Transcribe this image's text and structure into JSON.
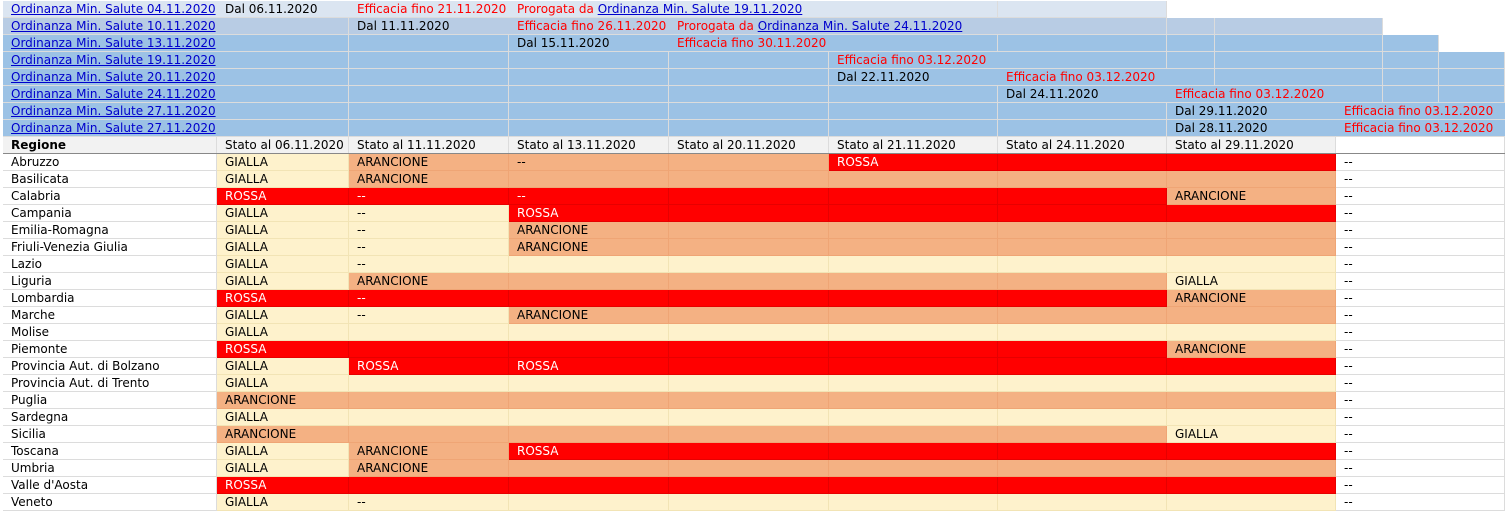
{
  "colors": {
    "ord_a": "#dbe5f1",
    "ord_b": "#b8cce4",
    "ord_c": "#9cc2e5",
    "header": "#f2f2f2",
    "gialla": "#fef2cc",
    "arancione": "#f4b183",
    "rossa": "#ff0000",
    "white": "#ffffff",
    "red_text": "#ff0000",
    "link": "#0000cc"
  },
  "ordinanze": [
    {
      "fill": "ord_a",
      "bands": 7,
      "cells": [
        {
          "col": 0,
          "parts": [
            {
              "t": "Ordinanza Min. Salute 04.11.2020",
              "s": "link"
            }
          ]
        },
        {
          "col": 1,
          "parts": [
            {
              "t": "Dal 06.11.2020"
            }
          ]
        },
        {
          "col": 2,
          "parts": [
            {
              "t": "Efficacia fino 21.11.2020",
              "s": "red"
            }
          ]
        },
        {
          "col": 3,
          "parts": [
            {
              "t": "Prorogata da ",
              "s": "red"
            },
            {
              "t": "Ordinanza Min. Salute 19.11.2020",
              "s": "link"
            }
          ]
        }
      ]
    },
    {
      "fill": "ord_b",
      "bands": 9,
      "cells": [
        {
          "col": 0,
          "parts": [
            {
              "t": "Ordinanza Min. Salute 10.11.2020",
              "s": "link"
            }
          ]
        },
        {
          "col": 2,
          "parts": [
            {
              "t": "Dal 11.11.2020"
            }
          ]
        },
        {
          "col": 3,
          "parts": [
            {
              "t": "Efficacia fino 26.11.2020",
              "s": "red"
            }
          ]
        },
        {
          "col": 4,
          "parts": [
            {
              "t": "Prorogata da ",
              "s": "red"
            },
            {
              "t": "Ordinanza Min. Salute 24.11.2020",
              "s": "link"
            }
          ]
        }
      ]
    },
    {
      "fill": "ord_c",
      "bands": 10,
      "cells": [
        {
          "col": 0,
          "parts": [
            {
              "t": "Ordinanza Min. Salute 13.11.2020",
              "s": "link"
            }
          ]
        },
        {
          "col": 3,
          "parts": [
            {
              "t": "Dal 15.11.2020"
            }
          ]
        },
        {
          "col": 4,
          "parts": [
            {
              "t": "Efficacia fino 30.11.2020",
              "s": "red"
            }
          ]
        }
      ]
    },
    {
      "fill": "ord_c",
      "bands": 11,
      "cells": [
        {
          "col": 0,
          "parts": [
            {
              "t": "Ordinanza Min. Salute 19.11.2020",
              "s": "link"
            }
          ]
        },
        {
          "col": 5,
          "parts": [
            {
              "t": "Efficacia fino 03.12.2020",
              "s": "red"
            }
          ]
        }
      ]
    },
    {
      "fill": "ord_c",
      "bands": 11,
      "cells": [
        {
          "col": 0,
          "parts": [
            {
              "t": "Ordinanza Min. Salute 20.11.2020",
              "s": "link"
            }
          ]
        },
        {
          "col": 5,
          "parts": [
            {
              "t": "Dal 22.11.2020"
            }
          ]
        },
        {
          "col": 6,
          "parts": [
            {
              "t": "Efficacia fino 03.12.2020",
              "s": "red"
            }
          ]
        }
      ]
    },
    {
      "fill": "ord_c",
      "bands": 11,
      "cells": [
        {
          "col": 0,
          "parts": [
            {
              "t": "Ordinanza Min. Salute 24.11.2020",
              "s": "link"
            }
          ]
        },
        {
          "col": 6,
          "parts": [
            {
              "t": "Dal 24.11.2020"
            }
          ]
        },
        {
          "col": 7,
          "parts": [
            {
              "t": "Efficacia fino 03.12.2020",
              "s": "red"
            }
          ]
        }
      ]
    },
    {
      "fill": "ord_c",
      "bands": 11,
      "cells": [
        {
          "col": 0,
          "parts": [
            {
              "t": "Ordinanza Min. Salute 27.11.2020",
              "s": "link"
            }
          ]
        },
        {
          "col": 7,
          "parts": [
            {
              "t": "Dal 29.11.2020"
            }
          ]
        },
        {
          "col": 8,
          "parts": [
            {
              "t": "Efficacia fino 03.12.2020",
              "s": "red"
            }
          ]
        }
      ]
    },
    {
      "fill": "ord_c",
      "bands": 11,
      "cells": [
        {
          "col": 0,
          "parts": [
            {
              "t": "Ordinanza Min. Salute 27.11.2020",
              "s": "link"
            }
          ]
        },
        {
          "col": 7,
          "parts": [
            {
              "t": "Dal 28.11.2020"
            }
          ]
        },
        {
          "col": 8,
          "parts": [
            {
              "t": "Efficacia fino 03.12.2020",
              "s": "red"
            }
          ]
        }
      ]
    }
  ],
  "header": {
    "region_label": "Regione",
    "stati": [
      "Stato al 06.11.2020",
      "Stato al 11.11.2020",
      "Stato al 13.11.2020",
      "Stato al 20.11.2020",
      "Stato al 21.11.2020",
      "Stato al 24.11.2020",
      "Stato al 29.11.2020",
      ""
    ]
  },
  "regions": [
    {
      "name": "Abruzzo",
      "bold": false,
      "cells": [
        {
          "f": "gialla",
          "t": "GIALLA"
        },
        {
          "f": "arancione",
          "t": "ARANCIONE"
        },
        {
          "f": "arancione",
          "t": "--"
        },
        {
          "f": "arancione",
          "t": ""
        },
        {
          "f": "rossa",
          "t": "ROSSA"
        },
        {
          "f": "rossa",
          "t": ""
        },
        {
          "f": "rossa",
          "t": ""
        },
        {
          "f": "white",
          "t": "--"
        }
      ]
    },
    {
      "name": "Basilicata",
      "bold": false,
      "cells": [
        {
          "f": "gialla",
          "t": "GIALLA"
        },
        {
          "f": "arancione",
          "t": "ARANCIONE"
        },
        {
          "f": "arancione",
          "t": ""
        },
        {
          "f": "arancione",
          "t": ""
        },
        {
          "f": "arancione",
          "t": ""
        },
        {
          "f": "arancione",
          "t": ""
        },
        {
          "f": "arancione",
          "t": ""
        },
        {
          "f": "white",
          "t": "--"
        }
      ]
    },
    {
      "name": "Calabria",
      "bold": false,
      "cells": [
        {
          "f": "rossa",
          "t": "ROSSA"
        },
        {
          "f": "rossa",
          "t": "--"
        },
        {
          "f": "rossa",
          "t": "--"
        },
        {
          "f": "rossa",
          "t": ""
        },
        {
          "f": "rossa",
          "t": ""
        },
        {
          "f": "rossa",
          "t": ""
        },
        {
          "f": "arancione",
          "t": "ARANCIONE"
        },
        {
          "f": "white",
          "t": "--"
        }
      ]
    },
    {
      "name": "Campania",
      "bold": false,
      "cells": [
        {
          "f": "gialla",
          "t": "GIALLA"
        },
        {
          "f": "gialla",
          "t": "--"
        },
        {
          "f": "rossa",
          "t": "ROSSA"
        },
        {
          "f": "rossa",
          "t": ""
        },
        {
          "f": "rossa",
          "t": ""
        },
        {
          "f": "rossa",
          "t": ""
        },
        {
          "f": "rossa",
          "t": ""
        },
        {
          "f": "white",
          "t": "--"
        }
      ]
    },
    {
      "name": "Emilia-Romagna",
      "bold": false,
      "cells": [
        {
          "f": "gialla",
          "t": "GIALLA"
        },
        {
          "f": "gialla",
          "t": "--"
        },
        {
          "f": "arancione",
          "t": "ARANCIONE"
        },
        {
          "f": "arancione",
          "t": ""
        },
        {
          "f": "arancione",
          "t": ""
        },
        {
          "f": "arancione",
          "t": ""
        },
        {
          "f": "arancione",
          "t": ""
        },
        {
          "f": "white",
          "t": "--"
        }
      ]
    },
    {
      "name": "Friuli-Venezia Giulia",
      "bold": false,
      "cells": [
        {
          "f": "gialla",
          "t": "GIALLA"
        },
        {
          "f": "gialla",
          "t": "--"
        },
        {
          "f": "arancione",
          "t": "ARANCIONE"
        },
        {
          "f": "arancione",
          "t": ""
        },
        {
          "f": "arancione",
          "t": ""
        },
        {
          "f": "arancione",
          "t": ""
        },
        {
          "f": "arancione",
          "t": ""
        },
        {
          "f": "white",
          "t": "--"
        }
      ]
    },
    {
      "name": "Lazio",
      "bold": false,
      "cells": [
        {
          "f": "gialla",
          "t": "GIALLA"
        },
        {
          "f": "gialla",
          "t": "--"
        },
        {
          "f": "gialla",
          "t": ""
        },
        {
          "f": "gialla",
          "t": ""
        },
        {
          "f": "gialla",
          "t": ""
        },
        {
          "f": "gialla",
          "t": ""
        },
        {
          "f": "gialla",
          "t": ""
        },
        {
          "f": "white",
          "t": "--"
        }
      ]
    },
    {
      "name": "Liguria",
      "bold": false,
      "cells": [
        {
          "f": "gialla",
          "t": "GIALLA"
        },
        {
          "f": "arancione",
          "t": "ARANCIONE"
        },
        {
          "f": "arancione",
          "t": ""
        },
        {
          "f": "arancione",
          "t": ""
        },
        {
          "f": "arancione",
          "t": ""
        },
        {
          "f": "arancione",
          "t": ""
        },
        {
          "f": "gialla",
          "t": "GIALLA"
        },
        {
          "f": "white",
          "t": "--"
        }
      ]
    },
    {
      "name": "Lombardia",
      "bold": false,
      "cells": [
        {
          "f": "rossa",
          "t": "ROSSA"
        },
        {
          "f": "rossa",
          "t": "--"
        },
        {
          "f": "rossa",
          "t": ""
        },
        {
          "f": "rossa",
          "t": ""
        },
        {
          "f": "rossa",
          "t": ""
        },
        {
          "f": "rossa",
          "t": ""
        },
        {
          "f": "arancione",
          "t": "ARANCIONE"
        },
        {
          "f": "white",
          "t": "--"
        }
      ]
    },
    {
      "name": "Marche",
      "bold": false,
      "cells": [
        {
          "f": "gialla",
          "t": "GIALLA"
        },
        {
          "f": "gialla",
          "t": "--"
        },
        {
          "f": "arancione",
          "t": "ARANCIONE"
        },
        {
          "f": "arancione",
          "t": ""
        },
        {
          "f": "arancione",
          "t": ""
        },
        {
          "f": "arancione",
          "t": ""
        },
        {
          "f": "arancione",
          "t": ""
        },
        {
          "f": "white",
          "t": "--"
        }
      ]
    },
    {
      "name": "Molise",
      "bold": false,
      "cells": [
        {
          "f": "gialla",
          "t": "GIALLA"
        },
        {
          "f": "gialla",
          "t": ""
        },
        {
          "f": "gialla",
          "t": ""
        },
        {
          "f": "gialla",
          "t": ""
        },
        {
          "f": "gialla",
          "t": ""
        },
        {
          "f": "gialla",
          "t": ""
        },
        {
          "f": "gialla",
          "t": ""
        },
        {
          "f": "white",
          "t": "--"
        }
      ]
    },
    {
      "name": "Piemonte",
      "bold": false,
      "cells": [
        {
          "f": "rossa",
          "t": "ROSSA"
        },
        {
          "f": "rossa",
          "t": ""
        },
        {
          "f": "rossa",
          "t": ""
        },
        {
          "f": "rossa",
          "t": ""
        },
        {
          "f": "rossa",
          "t": ""
        },
        {
          "f": "rossa",
          "t": ""
        },
        {
          "f": "arancione",
          "t": "ARANCIONE"
        },
        {
          "f": "white",
          "t": "--"
        }
      ]
    },
    {
      "name": "Provincia Aut. di Bolzano",
      "bold": false,
      "cells": [
        {
          "f": "gialla",
          "t": "GIALLA"
        },
        {
          "f": "rossa",
          "t": "ROSSA"
        },
        {
          "f": "rossa",
          "t": "ROSSA"
        },
        {
          "f": "rossa",
          "t": ""
        },
        {
          "f": "rossa",
          "t": ""
        },
        {
          "f": "rossa",
          "t": ""
        },
        {
          "f": "rossa",
          "t": ""
        },
        {
          "f": "white",
          "t": "--"
        }
      ]
    },
    {
      "name": "Provincia Aut. di Trento",
      "bold": false,
      "cells": [
        {
          "f": "gialla",
          "t": "GIALLA"
        },
        {
          "f": "gialla",
          "t": ""
        },
        {
          "f": "gialla",
          "t": ""
        },
        {
          "f": "gialla",
          "t": ""
        },
        {
          "f": "gialla",
          "t": ""
        },
        {
          "f": "gialla",
          "t": ""
        },
        {
          "f": "gialla",
          "t": ""
        },
        {
          "f": "white",
          "t": "--"
        }
      ]
    },
    {
      "name": "Puglia",
      "bold": false,
      "cells": [
        {
          "f": "arancione",
          "t": "ARANCIONE"
        },
        {
          "f": "arancione",
          "t": ""
        },
        {
          "f": "arancione",
          "t": ""
        },
        {
          "f": "arancione",
          "t": ""
        },
        {
          "f": "arancione",
          "t": ""
        },
        {
          "f": "arancione",
          "t": ""
        },
        {
          "f": "arancione",
          "t": ""
        },
        {
          "f": "white",
          "t": "--"
        }
      ]
    },
    {
      "name": "Sardegna",
      "bold": false,
      "cells": [
        {
          "f": "gialla",
          "t": "GIALLA"
        },
        {
          "f": "gialla",
          "t": ""
        },
        {
          "f": "gialla",
          "t": ""
        },
        {
          "f": "gialla",
          "t": ""
        },
        {
          "f": "gialla",
          "t": ""
        },
        {
          "f": "gialla",
          "t": ""
        },
        {
          "f": "gialla",
          "t": ""
        },
        {
          "f": "white",
          "t": "--"
        }
      ]
    },
    {
      "name": "Sicilia",
      "bold": false,
      "cells": [
        {
          "f": "arancione",
          "t": "ARANCIONE"
        },
        {
          "f": "arancione",
          "t": ""
        },
        {
          "f": "arancione",
          "t": ""
        },
        {
          "f": "arancione",
          "t": ""
        },
        {
          "f": "arancione",
          "t": ""
        },
        {
          "f": "arancione",
          "t": ""
        },
        {
          "f": "gialla",
          "t": "GIALLA"
        },
        {
          "f": "white",
          "t": "--"
        }
      ]
    },
    {
      "name": "Toscana",
      "bold": false,
      "cells": [
        {
          "f": "gialla",
          "t": "GIALLA"
        },
        {
          "f": "arancione",
          "t": "ARANCIONE"
        },
        {
          "f": "rossa",
          "t": "ROSSA"
        },
        {
          "f": "rossa",
          "t": ""
        },
        {
          "f": "rossa",
          "t": ""
        },
        {
          "f": "rossa",
          "t": ""
        },
        {
          "f": "rossa",
          "t": ""
        },
        {
          "f": "white",
          "t": "--"
        }
      ]
    },
    {
      "name": "Umbria",
      "bold": false,
      "cells": [
        {
          "f": "gialla",
          "t": "GIALLA"
        },
        {
          "f": "arancione",
          "t": "ARANCIONE"
        },
        {
          "f": "arancione",
          "t": ""
        },
        {
          "f": "arancione",
          "t": ""
        },
        {
          "f": "arancione",
          "t": ""
        },
        {
          "f": "arancione",
          "t": ""
        },
        {
          "f": "arancione",
          "t": ""
        },
        {
          "f": "white",
          "t": "--"
        }
      ]
    },
    {
      "name": "Valle d'Aosta",
      "bold": false,
      "cells": [
        {
          "f": "rossa",
          "t": "ROSSA"
        },
        {
          "f": "rossa",
          "t": ""
        },
        {
          "f": "rossa",
          "t": ""
        },
        {
          "f": "rossa",
          "t": ""
        },
        {
          "f": "rossa",
          "t": ""
        },
        {
          "f": "rossa",
          "t": ""
        },
        {
          "f": "rossa",
          "t": ""
        },
        {
          "f": "white",
          "t": "--"
        }
      ]
    },
    {
      "name": "Veneto",
      "bold": false,
      "cells": [
        {
          "f": "gialla",
          "t": "GIALLA"
        },
        {
          "f": "gialla",
          "t": "--"
        },
        {
          "f": "gialla",
          "t": ""
        },
        {
          "f": "gialla",
          "t": ""
        },
        {
          "f": "gialla",
          "t": ""
        },
        {
          "f": "gialla",
          "t": ""
        },
        {
          "f": "gialla",
          "t": ""
        },
        {
          "f": "white",
          "t": "--"
        }
      ]
    }
  ]
}
